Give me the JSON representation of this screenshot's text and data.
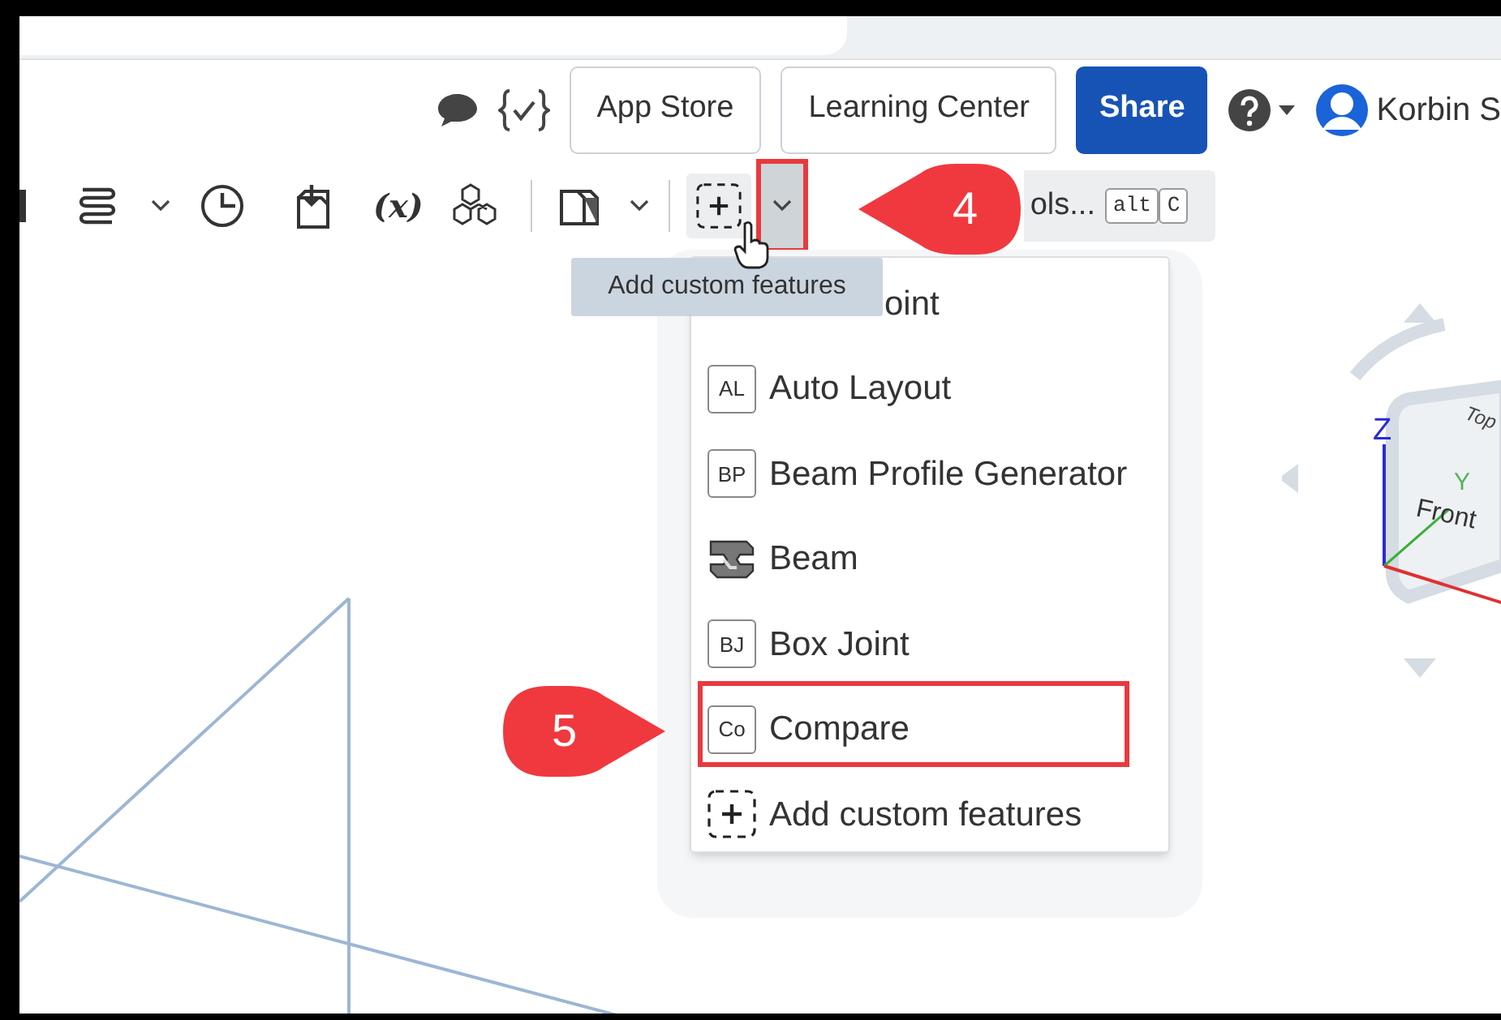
{
  "header": {
    "buttons": [
      {
        "label": "App Store",
        "kind": "outline"
      },
      {
        "label": "Learning Center",
        "kind": "outline"
      },
      {
        "label": "Share",
        "kind": "primary"
      }
    ],
    "user": "Korbin S"
  },
  "toolbar": {
    "variable_label": "(x)",
    "tools_search": "ols...",
    "shortcut_keys": [
      "alt",
      "C"
    ]
  },
  "tooltip": "Add custom features",
  "menu": {
    "items": [
      {
        "kind": "hidden",
        "label": "oint"
      },
      {
        "kind": "badge",
        "badge": "AL",
        "label": "Auto Layout"
      },
      {
        "kind": "badge",
        "badge": "BP",
        "label": "Beam Profile Generator"
      },
      {
        "kind": "beam",
        "label": "Beam"
      },
      {
        "kind": "badge",
        "badge": "BJ",
        "label": "Box Joint"
      },
      {
        "kind": "badge",
        "badge": "Co",
        "label": "Compare"
      },
      {
        "kind": "add",
        "label": "Add custom features"
      }
    ]
  },
  "view_cube": {
    "faces": [
      "Top",
      "Front"
    ],
    "axes": [
      "Z",
      "Y"
    ]
  },
  "callouts": [
    "4",
    "5"
  ]
}
